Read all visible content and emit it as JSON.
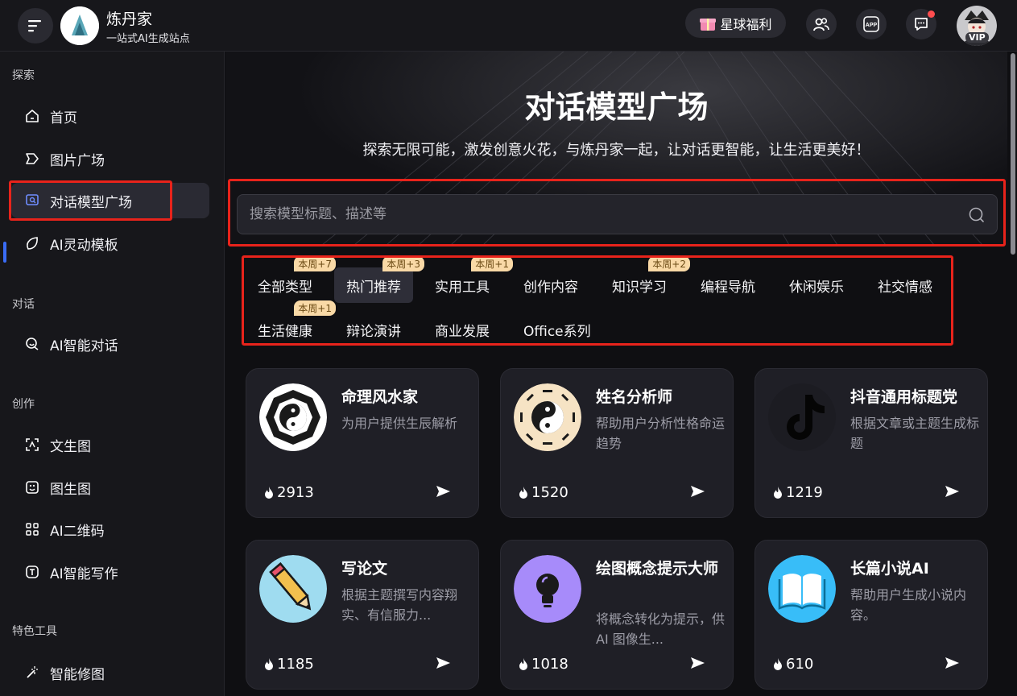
{
  "header": {
    "brand_name": "炼丹家",
    "brand_sub": "一站式AI生成站点",
    "welfare_label": "星球福利",
    "app_label": "APP",
    "vip_label": "VIP"
  },
  "sidebar": {
    "sections": {
      "explore": "探索",
      "chat": "对话",
      "create": "创作",
      "tools": "特色工具"
    },
    "items": {
      "home": "首页",
      "image_square": "图片广场",
      "chat_square": "对话模型广场",
      "ai_template": "AI灵动模板",
      "ai_chat": "AI智能对话",
      "text2img": "文生图",
      "img2img": "图生图",
      "qrcode": "AI二维码",
      "writing": "AI智能写作",
      "retouch": "智能修图"
    }
  },
  "hero": {
    "title": "对话模型广场",
    "subtitle": "探索无限可能，激发创意火花，与炼丹家一起，让对话更智能，让生活更美好！"
  },
  "search": {
    "placeholder": "搜索模型标题、描述等"
  },
  "categories": [
    {
      "label": "全部类型",
      "badge": "本周+7"
    },
    {
      "label": "热门推荐",
      "badge": "本周+3"
    },
    {
      "label": "实用工具",
      "badge": "本周+1"
    },
    {
      "label": "创作内容",
      "badge": ""
    },
    {
      "label": "知识学习",
      "badge": "本周+2"
    },
    {
      "label": "编程导航",
      "badge": ""
    },
    {
      "label": "休闲娱乐",
      "badge": ""
    },
    {
      "label": "社交情感",
      "badge": ""
    },
    {
      "label": "生活健康",
      "badge": "本周+1"
    },
    {
      "label": "辩论演讲",
      "badge": ""
    },
    {
      "label": "商业发展",
      "badge": ""
    },
    {
      "label": "Office系列",
      "badge": ""
    }
  ],
  "cards": [
    {
      "title": "命理风水家",
      "desc": "为用户提供生辰解析",
      "count": "2913",
      "icon": "bagua-icon"
    },
    {
      "title": "姓名分析师",
      "desc": "帮助用户分析性格命运趋势",
      "count": "1520",
      "icon": "yinyang-icon"
    },
    {
      "title": "抖音通用标题党",
      "desc": "根据文章或主题生成标题",
      "count": "1219",
      "icon": "tiktok-icon"
    },
    {
      "title": "写论文",
      "desc": "根据主题撰写内容翔实、有信服力...",
      "count": "1185",
      "icon": "pencil-icon"
    },
    {
      "title": "绘图概念提示大师",
      "desc": "将概念转化为提示，供 AI 图像生...",
      "count": "1018",
      "icon": "lightbulb-icon"
    },
    {
      "title": "长篇小说AI",
      "desc": "帮助用户生成小说内容。",
      "count": "610",
      "icon": "book-icon"
    }
  ],
  "colors": {
    "accent": "#3a6cf6",
    "highlight_box": "#e8231b",
    "badge_bg": "#f9d9a6"
  }
}
